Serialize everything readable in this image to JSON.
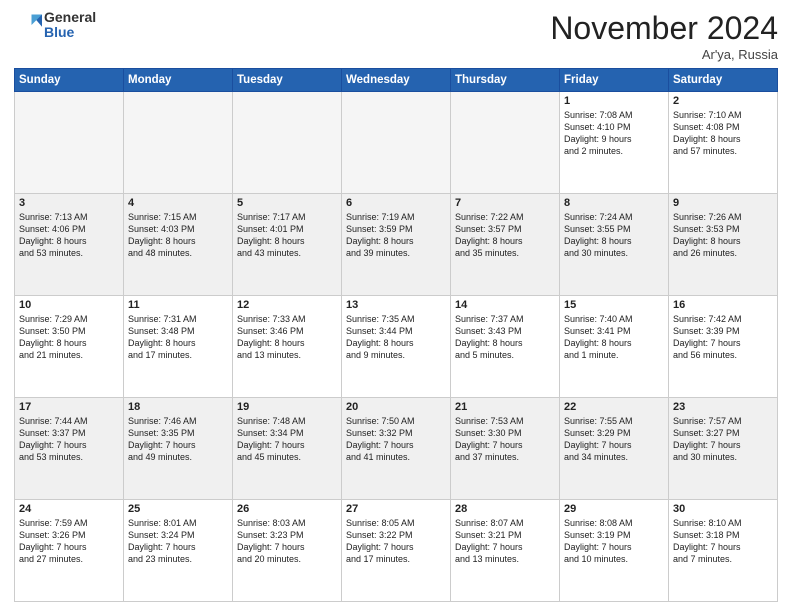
{
  "logo": {
    "general": "General",
    "blue": "Blue"
  },
  "title": "November 2024",
  "location": "Ar'ya, Russia",
  "weekdays": [
    "Sunday",
    "Monday",
    "Tuesday",
    "Wednesday",
    "Thursday",
    "Friday",
    "Saturday"
  ],
  "weeks": [
    [
      {
        "day": "",
        "info": ""
      },
      {
        "day": "",
        "info": ""
      },
      {
        "day": "",
        "info": ""
      },
      {
        "day": "",
        "info": ""
      },
      {
        "day": "",
        "info": ""
      },
      {
        "day": "1",
        "info": "Sunrise: 7:08 AM\nSunset: 4:10 PM\nDaylight: 9 hours\nand 2 minutes."
      },
      {
        "day": "2",
        "info": "Sunrise: 7:10 AM\nSunset: 4:08 PM\nDaylight: 8 hours\nand 57 minutes."
      }
    ],
    [
      {
        "day": "3",
        "info": "Sunrise: 7:13 AM\nSunset: 4:06 PM\nDaylight: 8 hours\nand 53 minutes."
      },
      {
        "day": "4",
        "info": "Sunrise: 7:15 AM\nSunset: 4:03 PM\nDaylight: 8 hours\nand 48 minutes."
      },
      {
        "day": "5",
        "info": "Sunrise: 7:17 AM\nSunset: 4:01 PM\nDaylight: 8 hours\nand 43 minutes."
      },
      {
        "day": "6",
        "info": "Sunrise: 7:19 AM\nSunset: 3:59 PM\nDaylight: 8 hours\nand 39 minutes."
      },
      {
        "day": "7",
        "info": "Sunrise: 7:22 AM\nSunset: 3:57 PM\nDaylight: 8 hours\nand 35 minutes."
      },
      {
        "day": "8",
        "info": "Sunrise: 7:24 AM\nSunset: 3:55 PM\nDaylight: 8 hours\nand 30 minutes."
      },
      {
        "day": "9",
        "info": "Sunrise: 7:26 AM\nSunset: 3:53 PM\nDaylight: 8 hours\nand 26 minutes."
      }
    ],
    [
      {
        "day": "10",
        "info": "Sunrise: 7:29 AM\nSunset: 3:50 PM\nDaylight: 8 hours\nand 21 minutes."
      },
      {
        "day": "11",
        "info": "Sunrise: 7:31 AM\nSunset: 3:48 PM\nDaylight: 8 hours\nand 17 minutes."
      },
      {
        "day": "12",
        "info": "Sunrise: 7:33 AM\nSunset: 3:46 PM\nDaylight: 8 hours\nand 13 minutes."
      },
      {
        "day": "13",
        "info": "Sunrise: 7:35 AM\nSunset: 3:44 PM\nDaylight: 8 hours\nand 9 minutes."
      },
      {
        "day": "14",
        "info": "Sunrise: 7:37 AM\nSunset: 3:43 PM\nDaylight: 8 hours\nand 5 minutes."
      },
      {
        "day": "15",
        "info": "Sunrise: 7:40 AM\nSunset: 3:41 PM\nDaylight: 8 hours\nand 1 minute."
      },
      {
        "day": "16",
        "info": "Sunrise: 7:42 AM\nSunset: 3:39 PM\nDaylight: 7 hours\nand 56 minutes."
      }
    ],
    [
      {
        "day": "17",
        "info": "Sunrise: 7:44 AM\nSunset: 3:37 PM\nDaylight: 7 hours\nand 53 minutes."
      },
      {
        "day": "18",
        "info": "Sunrise: 7:46 AM\nSunset: 3:35 PM\nDaylight: 7 hours\nand 49 minutes."
      },
      {
        "day": "19",
        "info": "Sunrise: 7:48 AM\nSunset: 3:34 PM\nDaylight: 7 hours\nand 45 minutes."
      },
      {
        "day": "20",
        "info": "Sunrise: 7:50 AM\nSunset: 3:32 PM\nDaylight: 7 hours\nand 41 minutes."
      },
      {
        "day": "21",
        "info": "Sunrise: 7:53 AM\nSunset: 3:30 PM\nDaylight: 7 hours\nand 37 minutes."
      },
      {
        "day": "22",
        "info": "Sunrise: 7:55 AM\nSunset: 3:29 PM\nDaylight: 7 hours\nand 34 minutes."
      },
      {
        "day": "23",
        "info": "Sunrise: 7:57 AM\nSunset: 3:27 PM\nDaylight: 7 hours\nand 30 minutes."
      }
    ],
    [
      {
        "day": "24",
        "info": "Sunrise: 7:59 AM\nSunset: 3:26 PM\nDaylight: 7 hours\nand 27 minutes."
      },
      {
        "day": "25",
        "info": "Sunrise: 8:01 AM\nSunset: 3:24 PM\nDaylight: 7 hours\nand 23 minutes."
      },
      {
        "day": "26",
        "info": "Sunrise: 8:03 AM\nSunset: 3:23 PM\nDaylight: 7 hours\nand 20 minutes."
      },
      {
        "day": "27",
        "info": "Sunrise: 8:05 AM\nSunset: 3:22 PM\nDaylight: 7 hours\nand 17 minutes."
      },
      {
        "day": "28",
        "info": "Sunrise: 8:07 AM\nSunset: 3:21 PM\nDaylight: 7 hours\nand 13 minutes."
      },
      {
        "day": "29",
        "info": "Sunrise: 8:08 AM\nSunset: 3:19 PM\nDaylight: 7 hours\nand 10 minutes."
      },
      {
        "day": "30",
        "info": "Sunrise: 8:10 AM\nSunset: 3:18 PM\nDaylight: 7 hours\nand 7 minutes."
      }
    ]
  ]
}
